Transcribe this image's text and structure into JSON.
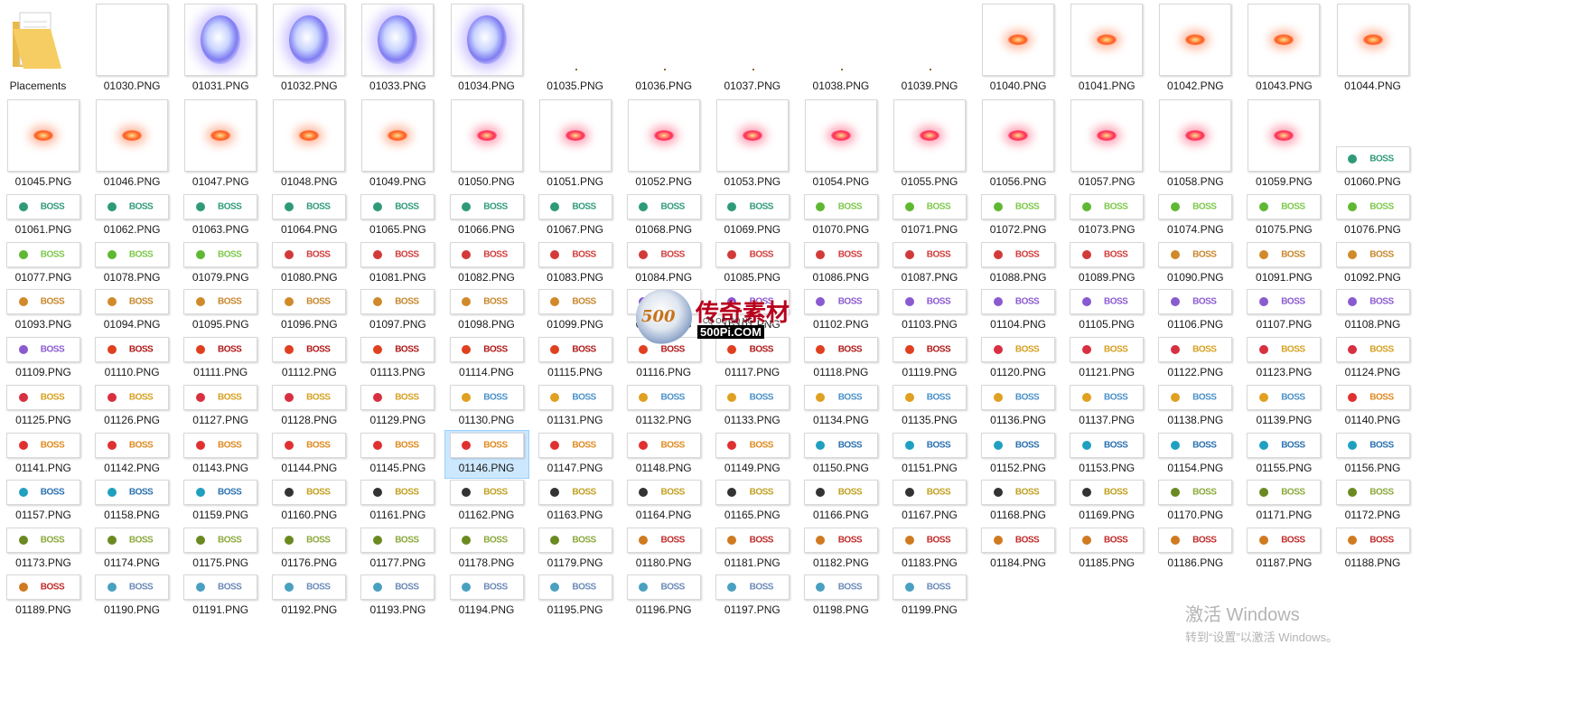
{
  "folder": {
    "label": "Placements",
    "icon": "folder-icon"
  },
  "files": [
    "01030.PNG",
    "01031.PNG",
    "01032.PNG",
    "01033.PNG",
    "01034.PNG",
    "01035.PNG",
    "01036.PNG",
    "01037.PNG",
    "01038.PNG",
    "01039.PNG",
    "01040.PNG",
    "01041.PNG",
    "01042.PNG",
    "01043.PNG",
    "01044.PNG",
    "01045.PNG",
    "01046.PNG",
    "01047.PNG",
    "01048.PNG",
    "01049.PNG",
    "01050.PNG",
    "01051.PNG",
    "01052.PNG",
    "01053.PNG",
    "01054.PNG",
    "01055.PNG",
    "01056.PNG",
    "01057.PNG",
    "01058.PNG",
    "01059.PNG",
    "01060.PNG",
    "01061.PNG",
    "01062.PNG",
    "01063.PNG",
    "01064.PNG",
    "01065.PNG",
    "01066.PNG",
    "01067.PNG",
    "01068.PNG",
    "01069.PNG",
    "01070.PNG",
    "01071.PNG",
    "01072.PNG",
    "01073.PNG",
    "01074.PNG",
    "01075.PNG",
    "01076.PNG",
    "01077.PNG",
    "01078.PNG",
    "01079.PNG",
    "01080.PNG",
    "01081.PNG",
    "01082.PNG",
    "01083.PNG",
    "01084.PNG",
    "01085.PNG",
    "01086.PNG",
    "01087.PNG",
    "01088.PNG",
    "01089.PNG",
    "01090.PNG",
    "01091.PNG",
    "01092.PNG",
    "01093.PNG",
    "01094.PNG",
    "01095.PNG",
    "01096.PNG",
    "01097.PNG",
    "01098.PNG",
    "01099.PNG",
    "01100.PNG",
    "01101.PNG",
    "01102.PNG",
    "01103.PNG",
    "01104.PNG",
    "01105.PNG",
    "01106.PNG",
    "01107.PNG",
    "01108.PNG",
    "01109.PNG",
    "01110.PNG",
    "01111.PNG",
    "01112.PNG",
    "01113.PNG",
    "01114.PNG",
    "01115.PNG",
    "01116.PNG",
    "01117.PNG",
    "01118.PNG",
    "01119.PNG",
    "01120.PNG",
    "01121.PNG",
    "01122.PNG",
    "01123.PNG",
    "01124.PNG",
    "01125.PNG",
    "01126.PNG",
    "01127.PNG",
    "01128.PNG",
    "01129.PNG",
    "01130.PNG",
    "01131.PNG",
    "01132.PNG",
    "01133.PNG",
    "01134.PNG",
    "01135.PNG",
    "01136.PNG",
    "01137.PNG",
    "01138.PNG",
    "01139.PNG",
    "01140.PNG",
    "01141.PNG",
    "01142.PNG",
    "01143.PNG",
    "01144.PNG",
    "01145.PNG",
    "01146.PNG",
    "01147.PNG",
    "01148.PNG",
    "01149.PNG",
    "01150.PNG",
    "01151.PNG",
    "01152.PNG",
    "01153.PNG",
    "01154.PNG",
    "01155.PNG",
    "01156.PNG",
    "01157.PNG",
    "01158.PNG",
    "01159.PNG",
    "01160.PNG",
    "01161.PNG",
    "01162.PNG",
    "01163.PNG",
    "01164.PNG",
    "01165.PNG",
    "01166.PNG",
    "01167.PNG",
    "01168.PNG",
    "01169.PNG",
    "01170.PNG",
    "01171.PNG",
    "01172.PNG",
    "01173.PNG",
    "01174.PNG",
    "01175.PNG",
    "01176.PNG",
    "01177.PNG",
    "01178.PNG",
    "01179.PNG",
    "01180.PNG",
    "01181.PNG",
    "01182.PNG",
    "01183.PNG",
    "01184.PNG",
    "01185.PNG",
    "01186.PNG",
    "01187.PNG",
    "01188.PNG",
    "01189.PNG",
    "01190.PNG",
    "01191.PNG",
    "01192.PNG",
    "01193.PNG",
    "01194.PNG",
    "01195.PNG",
    "01196.PNG",
    "01197.PNG",
    "01198.PNG",
    "01199.PNG"
  ],
  "selected_file": "01146.PNG",
  "badge_text": "BOSS",
  "watermark": {
    "logo_text": "500",
    "title": "传奇素材",
    "subtitle": "500Pi.COM",
    "small": "CQ OQ OQ NG"
  },
  "activation": {
    "title": "激活 Windows",
    "subtitle": "转到“设置”以激活 Windows。"
  },
  "colors": {
    "selection": "#cce8ff",
    "selection_border": "#99d1ff",
    "label": "#1a1a1a",
    "watermark_red": "#b7001d"
  }
}
